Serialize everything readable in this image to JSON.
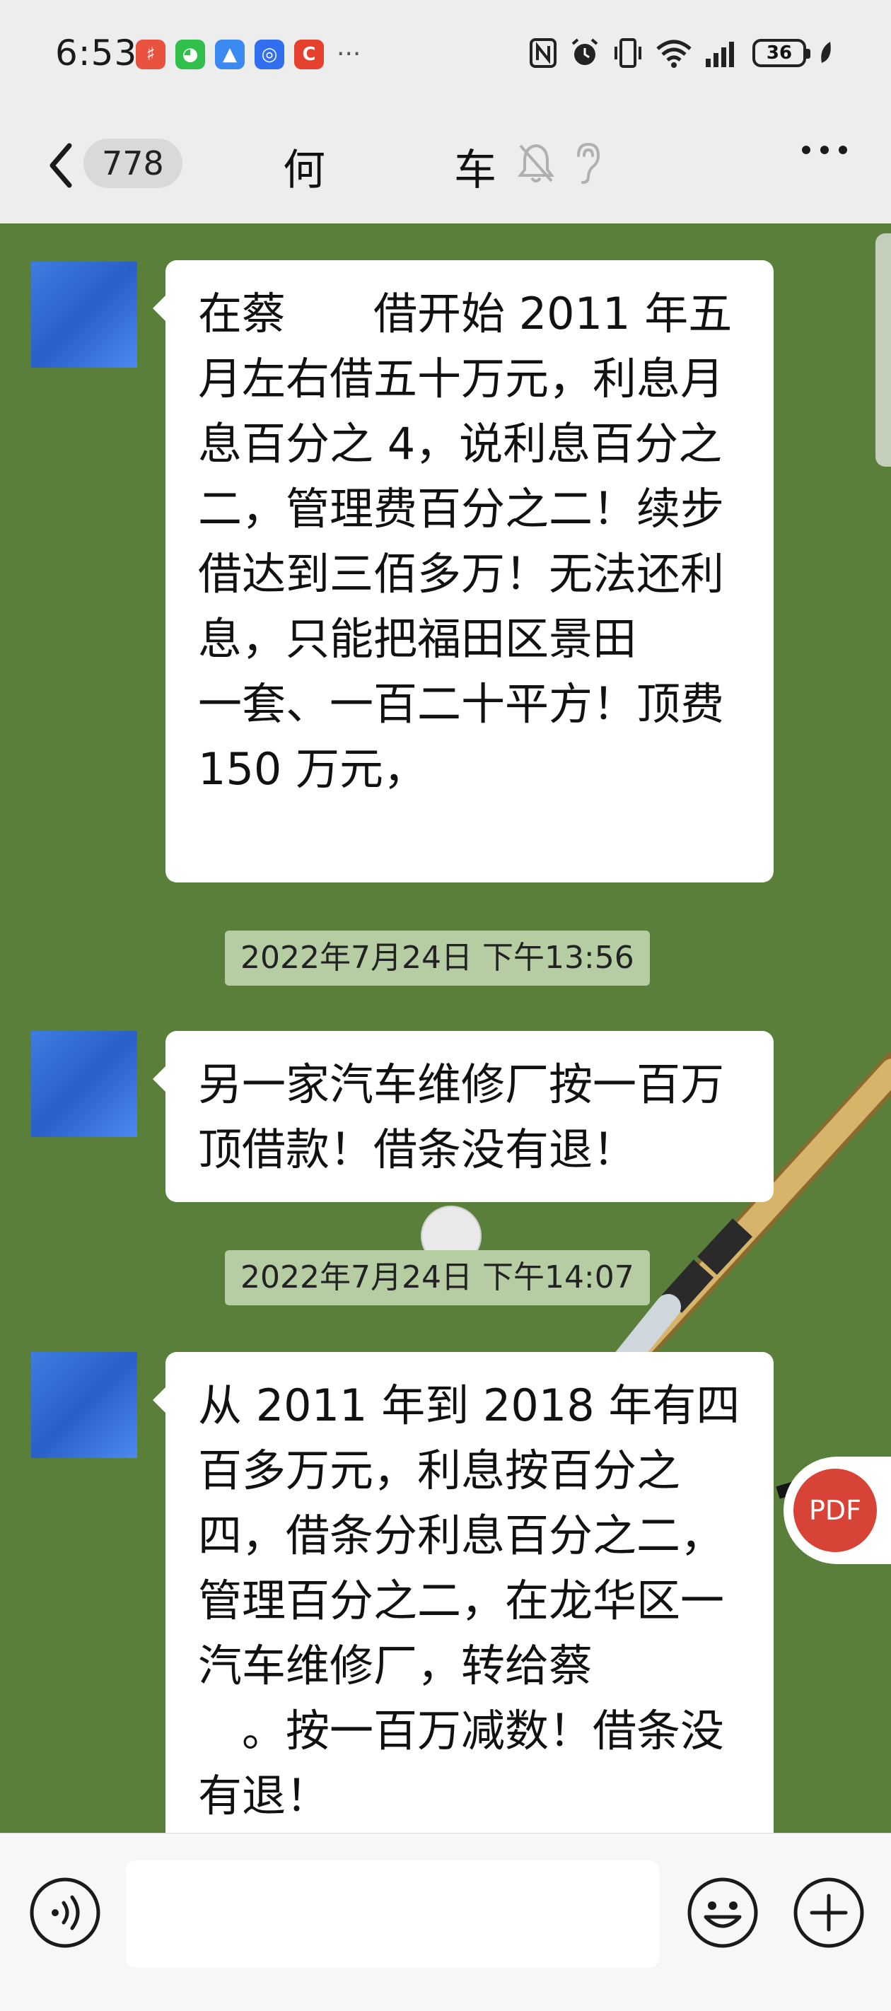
{
  "status_bar": {
    "time": "6:53",
    "notifications": [
      {
        "name": "app-notif-red-icon",
        "glyph": "♯",
        "color": "#e8523f"
      },
      {
        "name": "wechat-notif-icon",
        "glyph": "◕",
        "color": "#2fbf4a"
      },
      {
        "name": "app-notif-blue-icon",
        "glyph": "▲",
        "color": "#3b8af1"
      },
      {
        "name": "app-notif-ring-icon",
        "glyph": "◎",
        "color": "#2f6ff0"
      },
      {
        "name": "app-notif-c-icon",
        "glyph": "C",
        "color": "#e6402f"
      }
    ],
    "more": "···",
    "battery": "36"
  },
  "nav": {
    "unread_count": "778",
    "title_left": "何",
    "title_right": "车"
  },
  "messages": [
    {
      "text": "在蔡　　借开始 2011 年五月左右借五十万元，利息月息百分之 4，说利息百分之二，管理费百分之二！续步借达到三佰多万！无法还利息，只能把福田区景田\n一套、一百二十平方！顶费 150 万元，"
    },
    {
      "timestamp": "2022年7月24日 下午13:56",
      "text": "另一家汽车维修厂按一百万顶借款！借条没有退！"
    },
    {
      "timestamp": "2022年7月24日 下午14:07",
      "text": "从 2011 年到 2018 年有四百多万元，利息按百分之四，借条分利息百分之二，管理百分之二，在龙华区一汽车维修厂，转给蔡\n　。按一百万减数！借条没有退！"
    }
  ],
  "pdf_button": "PDF",
  "input": {
    "value": ""
  },
  "colors": {
    "chat_background": "#5a7f3a",
    "timestamp_background": "#b6cda3",
    "pdf_red": "#d84337"
  }
}
